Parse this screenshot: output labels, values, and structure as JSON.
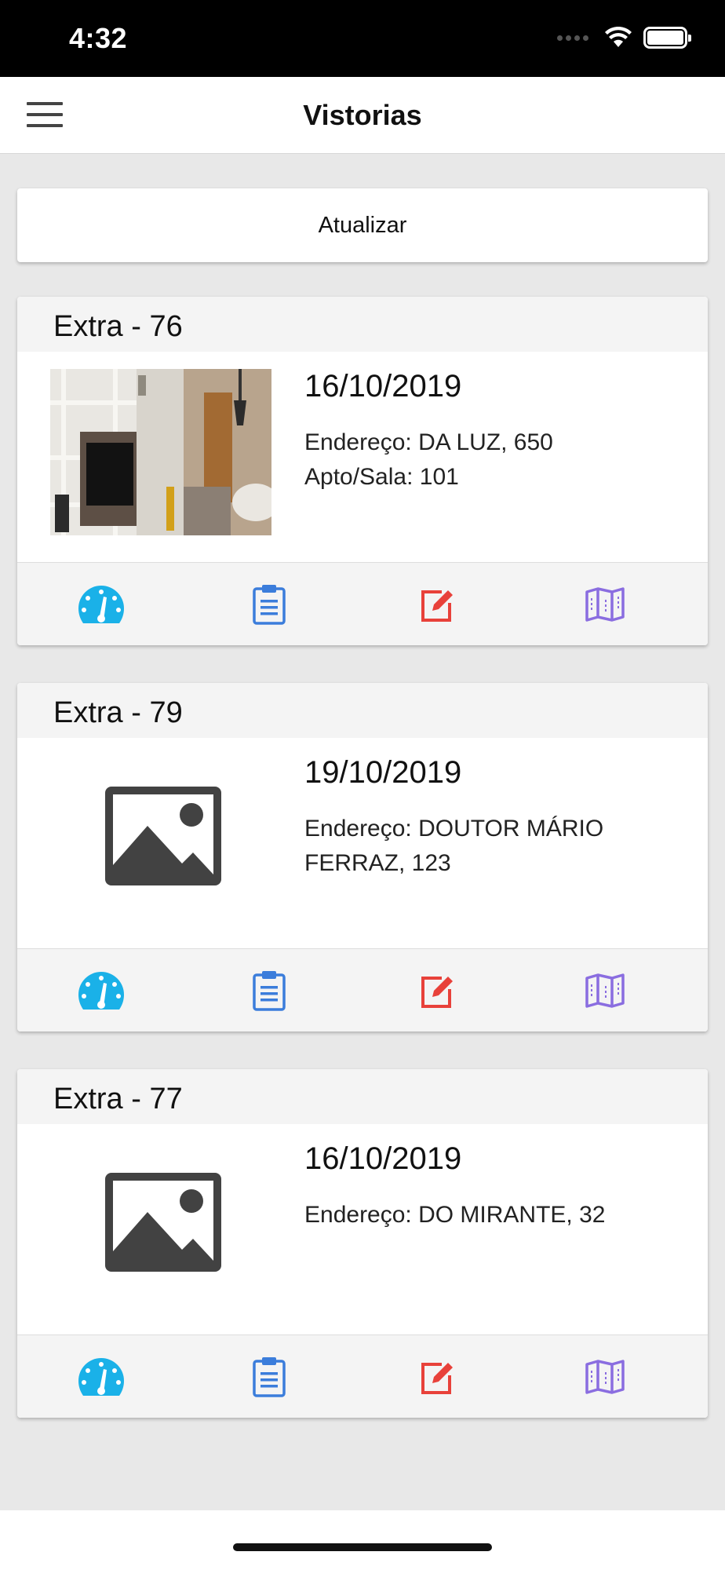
{
  "status_bar": {
    "time": "4:32"
  },
  "header": {
    "title": "Vistorias",
    "menu_icon": "hamburger-menu-icon"
  },
  "refresh_button": {
    "label": "Atualizar"
  },
  "cards": [
    {
      "title": "Extra - 76",
      "date": "16/10/2019",
      "address_line1": "Endereço: DA LUZ, 650",
      "address_line2": "Apto/Sala: 101",
      "has_photo": true
    },
    {
      "title": "Extra - 79",
      "date": "19/10/2019",
      "address_line1": "Endereço: DOUTOR MÁRIO",
      "address_line2": "FERRAZ, 123",
      "has_photo": false
    },
    {
      "title": "Extra - 77",
      "date": "16/10/2019",
      "address_line1": "Endereço: DO MIRANTE, 32",
      "address_line2": "",
      "has_photo": false
    }
  ],
  "actions": [
    {
      "name": "dashboard-icon",
      "color": "#1ab1e8"
    },
    {
      "name": "clipboard-icon",
      "color": "#3b7ddb"
    },
    {
      "name": "edit-icon",
      "color": "#e8413a"
    },
    {
      "name": "map-icon",
      "color": "#8a6de0"
    }
  ]
}
